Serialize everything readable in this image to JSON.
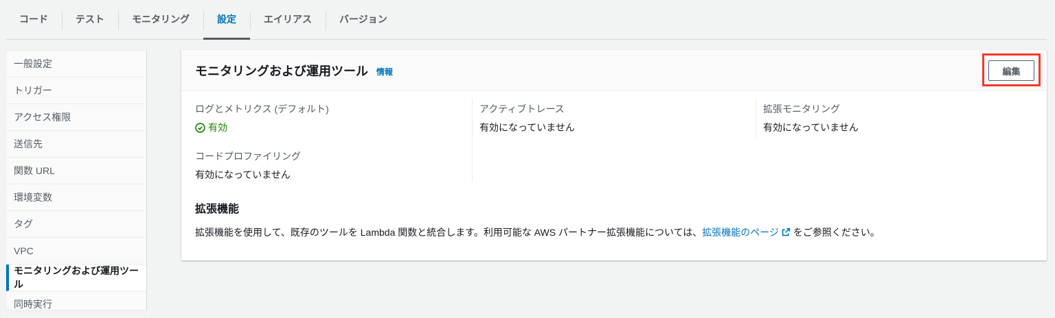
{
  "tabs": [
    "コード",
    "テスト",
    "モニタリング",
    "設定",
    "エイリアス",
    "バージョン"
  ],
  "sidebar": [
    "一般設定",
    "トリガー",
    "アクセス権限",
    "送信先",
    "関数 URL",
    "環境変数",
    "タグ",
    "VPC",
    "モニタリングおよび運用ツール",
    "同時実行"
  ],
  "card": {
    "title": "モニタリングおよび運用ツール",
    "info": "情報",
    "edit": "編集",
    "logs_label": "ログとメトリクス (デフォルト)",
    "logs_value": "有効",
    "trace_label": "アクティブトレース",
    "trace_value": "有効になっていません",
    "enh_label": "拡張モニタリング",
    "enh_value": "有効になっていません",
    "prof_label": "コードプロファイリング",
    "prof_value": "有効になっていません",
    "ext_title": "拡張機能",
    "ext_desc_before": "拡張機能を使用して、既存のツールを Lambda 関数と統合します。利用可能な AWS パートナー拡張機能については、",
    "ext_link": "拡張機能のページ",
    "ext_desc_after": " をご参照ください。"
  },
  "colors": {
    "accent": "#0073bb",
    "success": "#1d8102",
    "highlight": "#f23a2c"
  }
}
